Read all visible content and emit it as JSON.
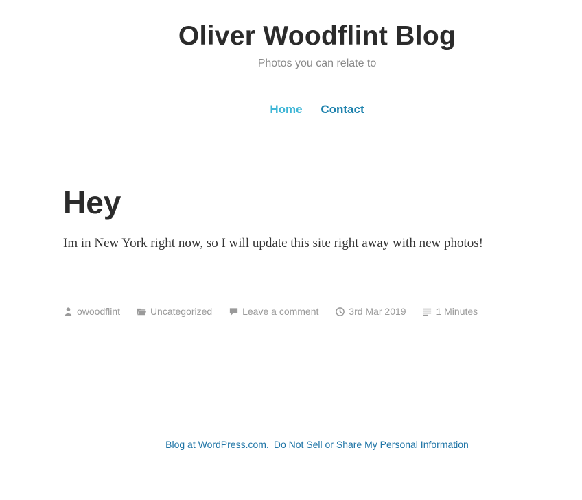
{
  "header": {
    "site_title": "Oliver Woodflint Blog",
    "tagline": "Photos you can relate to"
  },
  "nav": {
    "items": [
      {
        "label": "Home",
        "color": "#3fb6d6"
      },
      {
        "label": "Contact",
        "color": "#1e82ad"
      }
    ]
  },
  "post": {
    "title": "Hey",
    "body": "Im in New York right now, so I will update this site right away with new photos!",
    "meta": {
      "author": "owoodflint",
      "category": "Uncategorized",
      "comments": "Leave a comment",
      "date": "3rd Mar 2019",
      "reading_time": "1 Minutes"
    }
  },
  "footer": {
    "credit": "Blog at WordPress.com.",
    "privacy": "Do Not Sell or Share My Personal Information"
  },
  "colors": {
    "title_text": "#2b2b2b",
    "meta_gray": "#9a9a9a",
    "link_blue": "#1e74a6"
  }
}
